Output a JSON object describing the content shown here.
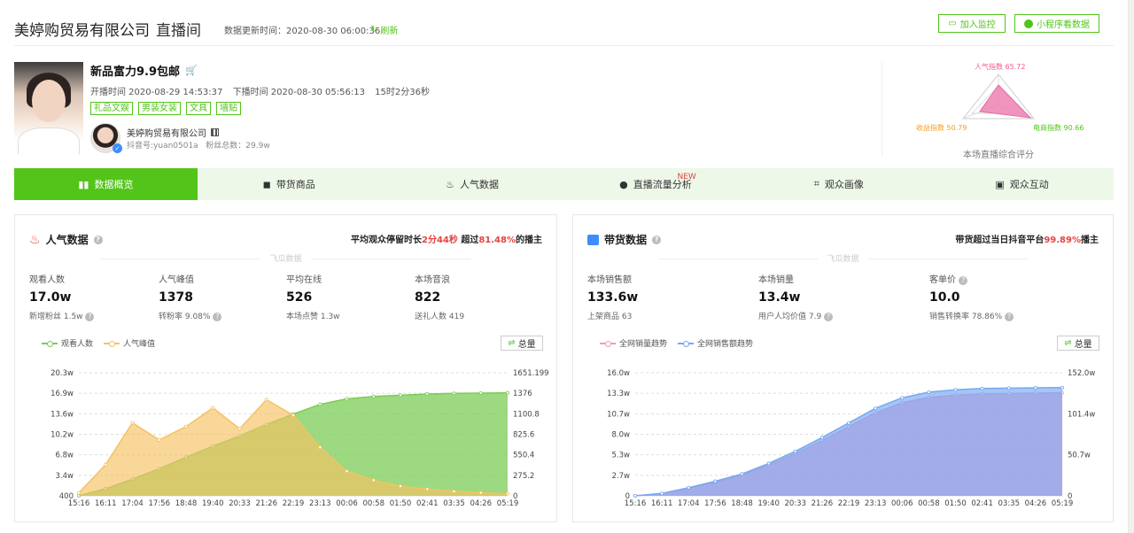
{
  "header": {
    "company": "美婷购贸易有限公司",
    "room": "直播间",
    "update_text": "数据更新时间：2020-08-30 06:00:36",
    "refresh_label": "刷新",
    "monitor_label": "加入监控",
    "mini_label": "小程序看数据"
  },
  "live": {
    "title": "新品富力9.9包邮",
    "start": "开播时间 2020-08-29 14:53:37",
    "end": "下播时间 2020-08-30 05:56:13",
    "duration": "15时2分36秒",
    "tags": [
      "礼品文娱",
      "男装女装",
      "文具",
      "墙贴"
    ],
    "anchor_name": "美婷购贸易有限公司",
    "anchor_id": "抖音号:yuan0501a",
    "fans": "粉丝总数：29.9w"
  },
  "radar": {
    "popularity": "人气指数 65.72",
    "income": "收益指数 50.79",
    "ecommerce": "电商指数 90.66",
    "caption": "本场直播综合评分",
    "values": [
      65.72,
      90.66,
      50.79
    ]
  },
  "tabs": [
    {
      "label": "数据概览",
      "icon": "bar-chart-icon"
    },
    {
      "label": "带货商品",
      "icon": "bag-icon"
    },
    {
      "label": "人气数据",
      "icon": "fire-icon"
    },
    {
      "label": "直播流量分析",
      "icon": "flow-icon",
      "badge": "NEW"
    },
    {
      "label": "观众画像",
      "icon": "portrait-icon"
    },
    {
      "label": "观众互动",
      "icon": "chat-icon"
    }
  ],
  "popularity_panel": {
    "title": "人气数据",
    "summary_pre": "平均观众停留时长",
    "summary_time": "2分44秒",
    "summary_mid": " 超过",
    "summary_pct": "81.48%",
    "summary_post": "的播主",
    "watermark": "飞瓜数据",
    "metrics": [
      {
        "label": "观看人数",
        "value": "17.0w",
        "sub": "新增粉丝 1.5w"
      },
      {
        "label": "人气峰值",
        "value": "1378",
        "sub": "转粉率 9.08%"
      },
      {
        "label": "平均在线",
        "value": "526",
        "sub": "本场点赞 1.3w"
      },
      {
        "label": "本场音浪",
        "value": "822",
        "sub": "送礼人数 419"
      }
    ],
    "legend": [
      "观看人数",
      "人气峰值"
    ],
    "total_label": "总量"
  },
  "sales_panel": {
    "title": "带货数据",
    "summary_pre": "带货超过当日抖音平台",
    "summary_pct": "99.89%",
    "summary_post": "播主",
    "watermark": "飞瓜数据",
    "metrics": [
      {
        "label": "本场销售额",
        "value": "133.6w",
        "sub": "上架商品 63"
      },
      {
        "label": "本场销量",
        "value": "13.4w",
        "sub": "用户人均价值 7.9"
      },
      {
        "label": "客单价",
        "value": "10.0",
        "sub": "销售转换率 78.86%"
      }
    ],
    "legend": [
      "全网销量趋势",
      "全网销售额趋势"
    ],
    "total_label": "总量"
  },
  "chart_data": [
    {
      "type": "area",
      "x": [
        "15:16",
        "16:11",
        "17:04",
        "17:56",
        "18:48",
        "19:40",
        "20:33",
        "21:26",
        "22:19",
        "23:13",
        "00:06",
        "00:58",
        "01:50",
        "02:41",
        "03:35",
        "04:26",
        "05:19"
      ],
      "y_left_ticks": [
        "400",
        "3.4w",
        "6.8w",
        "10.2w",
        "13.6w",
        "16.9w",
        "20.3w"
      ],
      "y_right_ticks": [
        "0",
        "275.2",
        "550.4",
        "825.6",
        "1100.8",
        "1376",
        "1651.199"
      ],
      "series": [
        {
          "name": "观看人数",
          "axis": "left",
          "color": "#7ccc55",
          "values": [
            400,
            12000,
            28000,
            45000,
            64000,
            82000,
            99000,
            118000,
            135000,
            151000,
            160000,
            164000,
            166000,
            168000,
            169000,
            169500,
            170000
          ]
        },
        {
          "name": "人气峰值",
          "axis": "right",
          "color": "#f4c263",
          "values": [
            40,
            420,
            980,
            750,
            930,
            1180,
            900,
            1290,
            1080,
            650,
            330,
            210,
            130,
            90,
            60,
            40,
            30
          ]
        }
      ]
    },
    {
      "type": "area",
      "x": [
        "15:16",
        "16:11",
        "17:04",
        "17:56",
        "18:48",
        "19:40",
        "20:33",
        "21:26",
        "22:19",
        "23:13",
        "00:06",
        "00:58",
        "01:50",
        "02:41",
        "03:35",
        "04:26",
        "05:19"
      ],
      "y_left_ticks": [
        "0",
        "2.7w",
        "5.3w",
        "8.0w",
        "10.7w",
        "13.3w",
        "16.0w"
      ],
      "y_right_ticks": [
        "0",
        "50.7w",
        "101.4w",
        "152.0w"
      ],
      "series": [
        {
          "name": "全网销量趋势",
          "axis": "left",
          "color": "#ef9ac6",
          "values": [
            0,
            3000,
            10000,
            18000,
            27000,
            40000,
            55000,
            72000,
            90000,
            108000,
            121000,
            128000,
            131000,
            132500,
            133000,
            133500,
            134000
          ]
        },
        {
          "name": "全网销售额趋势",
          "axis": "right",
          "color": "#74a9f2",
          "values": [
            0,
            30000,
            100000,
            180000,
            270000,
            400000,
            550000,
            720000,
            900000,
            1080000,
            1210000,
            1280000,
            1310000,
            1325000,
            1330000,
            1334000,
            1336000
          ]
        }
      ]
    }
  ]
}
